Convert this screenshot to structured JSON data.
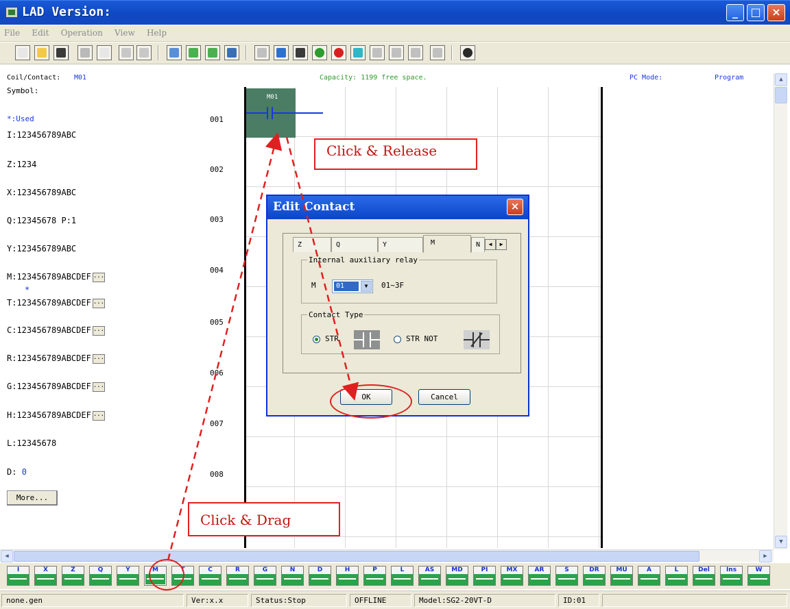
{
  "window": {
    "title": "LAD Version:"
  },
  "menu": [
    "File",
    "Edit",
    "Operation",
    "View",
    "Help"
  ],
  "info": {
    "coil_contact_label": "Coil/Contact:",
    "coil_contact_value": "M01",
    "capacity": "Capacity: 1199 free space.",
    "pc_mode_label": "PC Mode:",
    "pc_mode_value": "Program"
  },
  "left_panel": {
    "symbol": "Symbol:",
    "used": "*:Used",
    "lines": [
      "I:123456789ABC",
      "Z:1234",
      "X:123456789ABC",
      "Q:12345678 P:1",
      "Y:123456789ABC",
      "M:123456789ABCDEF",
      "T:123456789ABCDEF",
      "C:123456789ABCDEF",
      "R:123456789ABCDEF",
      "G:123456789ABCDEF",
      "H:123456789ABCDEF",
      "L:12345678"
    ],
    "used_marker": "*",
    "d_label": "D:",
    "d_value": "0",
    "more_button": "More...",
    "dots": "..."
  },
  "ladder": {
    "rows": [
      "001",
      "002",
      "003",
      "004",
      "005",
      "006",
      "007",
      "008"
    ],
    "cell_label": "M01"
  },
  "dialog": {
    "title": "Edit Contact",
    "tabs": [
      "Z",
      "Q",
      "Y",
      "M",
      "N"
    ],
    "group1_label": "Internal auxiliary relay",
    "relay_prefix": "M",
    "relay_value": "01",
    "relay_range": "01~3F",
    "group2_label": "Contact Type",
    "opt1": "STR",
    "opt2": "STR NOT",
    "ok": "OK",
    "cancel": "Cancel"
  },
  "annotations": {
    "click_release": "Click & Release",
    "click_drag": "Click & Drag"
  },
  "palette": [
    {
      "label": "I"
    },
    {
      "label": "X"
    },
    {
      "label": "Z"
    },
    {
      "label": "Q"
    },
    {
      "label": "Y"
    },
    {
      "label": "M",
      "selected": true
    },
    {
      "label": "T"
    },
    {
      "label": "C"
    },
    {
      "label": "R"
    },
    {
      "label": "G"
    },
    {
      "label": "N"
    },
    {
      "label": "D"
    },
    {
      "label": "H"
    },
    {
      "label": "P"
    },
    {
      "label": "L"
    },
    {
      "label": "AS"
    },
    {
      "label": "MD"
    },
    {
      "label": "PI"
    },
    {
      "label": "MX"
    },
    {
      "label": "AR"
    },
    {
      "label": "S"
    },
    {
      "label": "DR"
    },
    {
      "label": "MU"
    },
    {
      "label": "A"
    },
    {
      "label": "L"
    },
    {
      "label": "Del"
    },
    {
      "label": "Ins"
    },
    {
      "label": "W"
    }
  ],
  "status": {
    "file": "none.gen",
    "ver": "Ver:x.x",
    "state": "Status:Stop",
    "conn": "OFFLINE",
    "model": "Model:SG2-20VT-D",
    "id": "ID:01"
  },
  "toolbar_icons": [
    "new-icon",
    "open-icon",
    "save-icon",
    "tools-icon",
    "preview-icon",
    "undo-icon",
    "redo-icon",
    "ladder-view-icon",
    "fbd-view-icon",
    "monitor-icon",
    "comment-icon",
    "connect-icon",
    "refresh-icon",
    "settings-icon",
    "run-icon",
    "stop-icon",
    "quit-icon",
    "read-icon",
    "write-icon",
    "compare-icon",
    "upload-icon",
    "help-icon"
  ],
  "colors": {
    "accent": "#0f48c2",
    "annotation": "#e02020",
    "selected_cell": "#4a7d64",
    "palette": "#2da24a"
  }
}
